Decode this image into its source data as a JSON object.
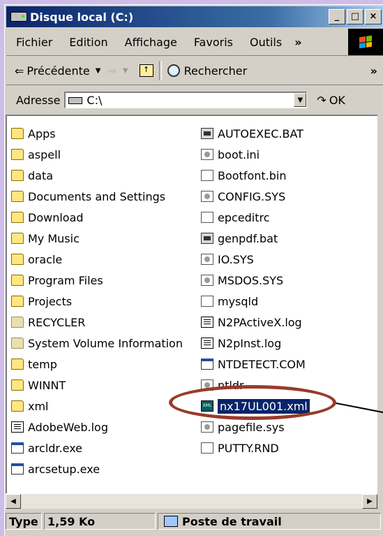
{
  "window": {
    "title": "Disque local (C:)",
    "controls": {
      "minimize": "_",
      "maximize": "□",
      "close": "×"
    }
  },
  "menu": {
    "items": [
      "Fichier",
      "Edition",
      "Affichage",
      "Favoris",
      "Outils"
    ],
    "more": "»"
  },
  "toolbar": {
    "back_label": "Précédente",
    "search_label": "Rechercher",
    "more": "»"
  },
  "address": {
    "label": "Adresse",
    "value": "C:\\",
    "go_label": "OK"
  },
  "files": {
    "left": [
      {
        "name": "Apps",
        "icon": "folder-icon"
      },
      {
        "name": "aspell",
        "icon": "folder-icon"
      },
      {
        "name": "data",
        "icon": "folder-icon"
      },
      {
        "name": "Documents and Settings",
        "icon": "folder-icon"
      },
      {
        "name": "Download",
        "icon": "folder-icon"
      },
      {
        "name": "My Music",
        "icon": "folder-icon"
      },
      {
        "name": "oracle",
        "icon": "folder-icon"
      },
      {
        "name": "Program Files",
        "icon": "folder-icon"
      },
      {
        "name": "Projects",
        "icon": "folder-icon"
      },
      {
        "name": "RECYCLER",
        "icon": "hidden-folder-icon"
      },
      {
        "name": "System Volume Information",
        "icon": "hidden-folder-icon"
      },
      {
        "name": "temp",
        "icon": "folder-icon"
      },
      {
        "name": "WINNT",
        "icon": "folder-icon"
      },
      {
        "name": "xml",
        "icon": "folder-icon"
      },
      {
        "name": "AdobeWeb.log",
        "icon": "text-file-icon"
      },
      {
        "name": "arcldr.exe",
        "icon": "exe-icon"
      },
      {
        "name": "arcsetup.exe",
        "icon": "exe-icon"
      }
    ],
    "right": [
      {
        "name": "AUTOEXEC.BAT",
        "icon": "batch-file-icon"
      },
      {
        "name": "boot.ini",
        "icon": "ini-file-icon"
      },
      {
        "name": "Bootfont.bin",
        "icon": "file-icon"
      },
      {
        "name": "CONFIG.SYS",
        "icon": "system-file-icon"
      },
      {
        "name": "epceditrc",
        "icon": "file-icon"
      },
      {
        "name": "genpdf.bat",
        "icon": "batch-file-icon"
      },
      {
        "name": "IO.SYS",
        "icon": "system-file-icon"
      },
      {
        "name": "MSDOS.SYS",
        "icon": "system-file-icon"
      },
      {
        "name": "mysqld",
        "icon": "file-icon"
      },
      {
        "name": "N2PActiveX.log",
        "icon": "text-file-icon"
      },
      {
        "name": "N2pInst.log",
        "icon": "text-file-icon"
      },
      {
        "name": "NTDETECT.COM",
        "icon": "exe-icon"
      },
      {
        "name": "ntldr",
        "icon": "system-file-icon"
      },
      {
        "name": "nx17UL001.xml",
        "icon": "xml-file-icon",
        "selected": true
      },
      {
        "name": "pagefile.sys",
        "icon": "system-file-icon"
      },
      {
        "name": "PUTTY.RND",
        "icon": "file-icon"
      }
    ]
  },
  "status": {
    "type_label": "Type",
    "size": "1,59 Ko",
    "location": "Poste de travail"
  },
  "colors": {
    "selection": "#0a246a",
    "highlight_circle": "#9a3a2a",
    "title_gradient_start": "#0a246a"
  }
}
